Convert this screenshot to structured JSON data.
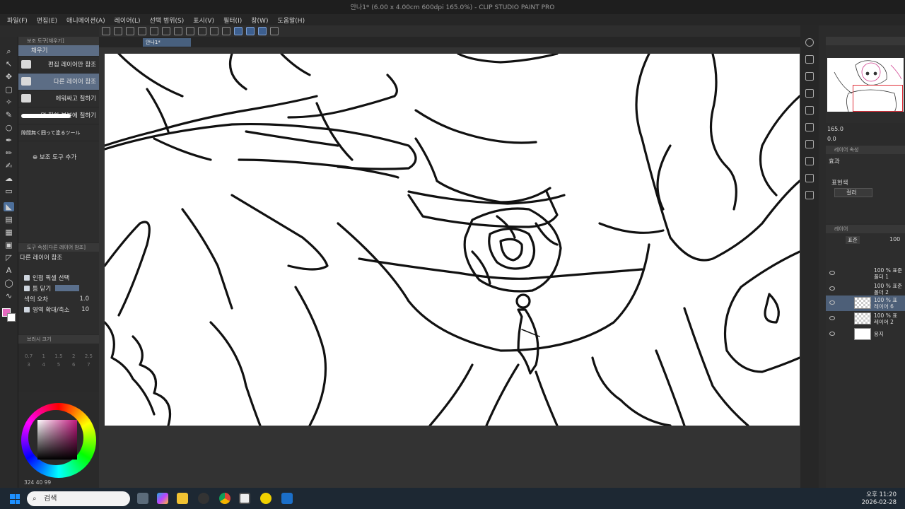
{
  "window": {
    "title": "안나1* (6.00 x 4.00cm 600dpi 165.0%)  - CLIP STUDIO PAINT PRO"
  },
  "menu": [
    "파일(F)",
    "편집(E)",
    "애니메이션(A)",
    "레이어(L)",
    "선택 범위(S)",
    "표시(V)",
    "필터(I)",
    "창(W)",
    "도움말(H)"
  ],
  "subtool": {
    "header": "보조 도구[채우기]",
    "group": "채우기",
    "items": [
      {
        "label": "편집 레이어만 참조"
      },
      {
        "label": "다른 레이어 참조"
      },
      {
        "label": "에워싸고 칠하기"
      },
      {
        "label": "덜 칠한 부분에 칠하기"
      },
      {
        "label": "隙間無く囲って塗るツール"
      }
    ],
    "add_label": "보조 도구 추가"
  },
  "tool_property": {
    "header": "도구 속성[다른 레이어 참조]",
    "title": "다른 레이어 참조",
    "adjacent": "인접 픽셀 선택",
    "close_gap": "틈 닫기",
    "tolerance_label": "색의 오차",
    "tolerance_value": "1.0",
    "expand_label": "영역 확대/축소",
    "expand_value": "10"
  },
  "brush_size": {
    "header": "브러시 크기",
    "values": [
      "0.7",
      "1",
      "1.5",
      "2",
      "2.5",
      "3",
      "4",
      "5",
      "6",
      "7"
    ]
  },
  "color": {
    "readout": "324 40 99",
    "main": "#e66ac0",
    "sub": "#ffffff"
  },
  "document_tab": "안나1*",
  "navigator": {
    "zoom": "165.0",
    "angle": "0.0"
  },
  "layer_property": {
    "header": "레이어 속성",
    "effect_label": "효과",
    "expression_label": "표현색",
    "expression_value": "컬러"
  },
  "layer_panel": {
    "header": "레이어",
    "blend": "표준",
    "opacity": "100",
    "layers": [
      {
        "name": "100 % 표준\n폴더 1",
        "selected": false
      },
      {
        "name": "100 % 표준\n폴더 2",
        "selected": false
      },
      {
        "name": "100 % 표\n레이어 6",
        "selected": true
      },
      {
        "name": "100 % 표\n레이어 2",
        "selected": false
      },
      {
        "name": "용지",
        "selected": false
      }
    ]
  },
  "taskbar": {
    "search_placeholder": "검색",
    "time": "오후 11:20",
    "date": "2026-02-28"
  }
}
